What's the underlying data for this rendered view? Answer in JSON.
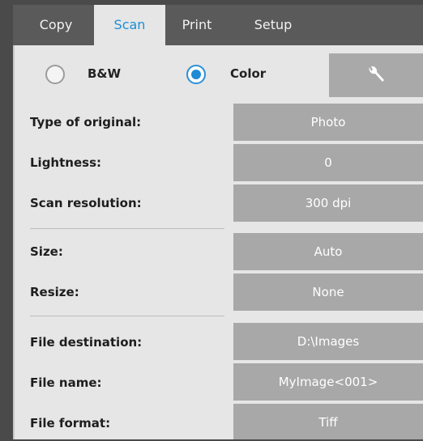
{
  "tabs": [
    {
      "label": "Copy",
      "active": false
    },
    {
      "label": "Scan",
      "active": true
    },
    {
      "label": "Print",
      "active": false
    },
    {
      "label": "Setup",
      "active": false
    }
  ],
  "color_mode": {
    "options": [
      {
        "label": "B&W",
        "selected": false
      },
      {
        "label": "Color",
        "selected": true
      }
    ]
  },
  "settings_button_icon": "wrench-icon",
  "settings": [
    {
      "label": "Type of original:",
      "value": "Photo"
    },
    {
      "label": "Lightness:",
      "value": "0"
    },
    {
      "label": "Scan resolution:",
      "value": "300 dpi"
    },
    {
      "label": "Size:",
      "value": "Auto"
    },
    {
      "label": "Resize:",
      "value": "None"
    },
    {
      "label": "File destination:",
      "value": "D:\\Images"
    },
    {
      "label": "File name:",
      "value": "MyImage<001>"
    },
    {
      "label": "File format:",
      "value": "Tiff"
    }
  ],
  "colors": {
    "active_tab_text": "#1a8fd8",
    "tab_bar": "#5a5a5a",
    "value_button": "#a8a8a8",
    "radio_selected": "#1f8ad6"
  }
}
